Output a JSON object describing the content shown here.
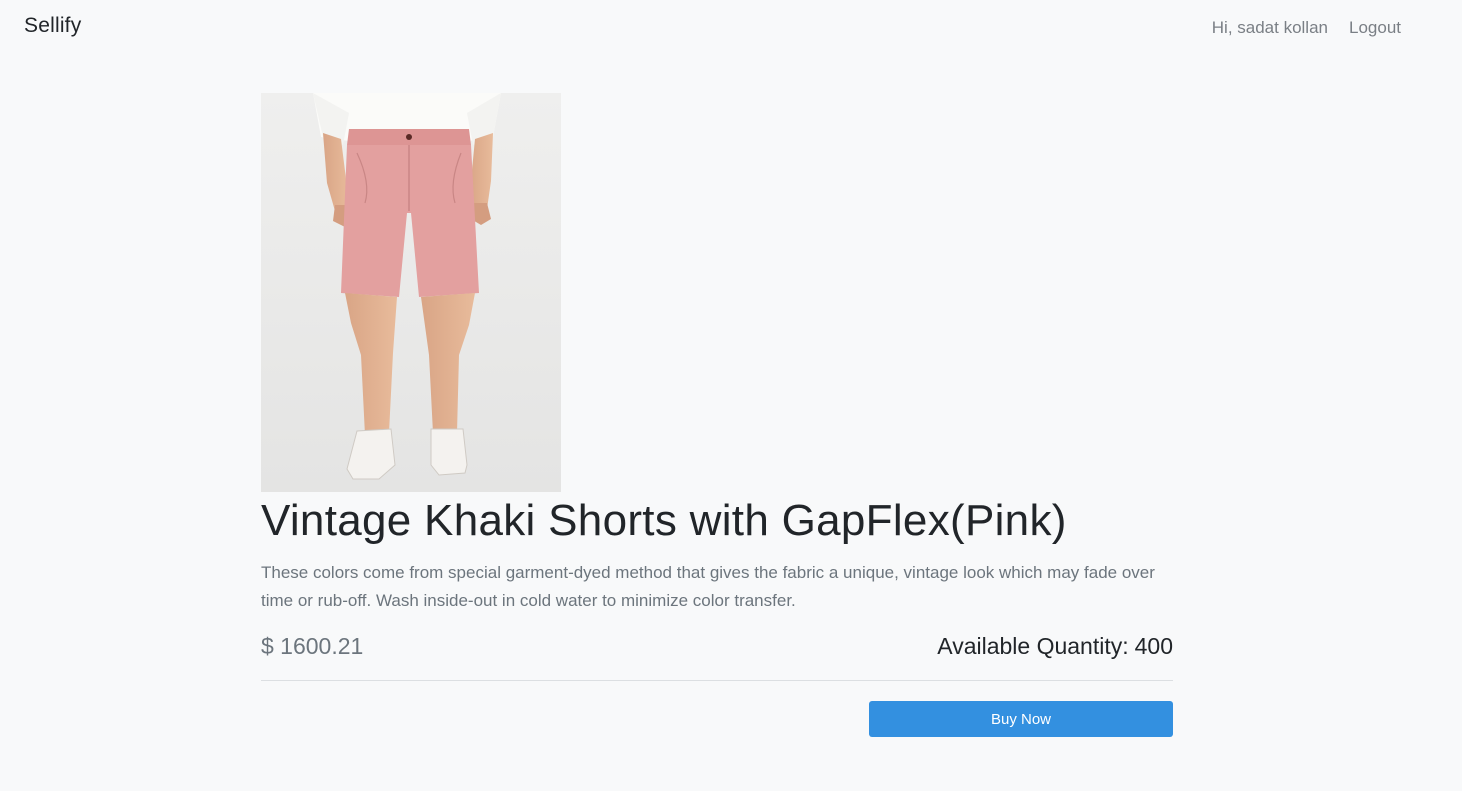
{
  "navbar": {
    "brand": "Sellify",
    "greeting": "Hi, sadat kollan",
    "logout_label": "Logout"
  },
  "product": {
    "image_alt": "Pink khaki shorts worn by model",
    "title": "Vintage Khaki Shorts with GapFlex(Pink)",
    "description": "These colors come from special garment-dyed method that gives the fabric a unique, vintage look which may fade over time or rub-off. Wash inside-out in cold water to minimize color transfer.",
    "price": "$ 1600.21",
    "quantity_label": "Available Quantity:",
    "quantity_value": "400",
    "buy_label": "Buy Now"
  },
  "colors": {
    "accent": "#3390e0",
    "background": "#f8f9fa",
    "muted_text": "#6c757d",
    "shorts": "#e3a09f"
  }
}
